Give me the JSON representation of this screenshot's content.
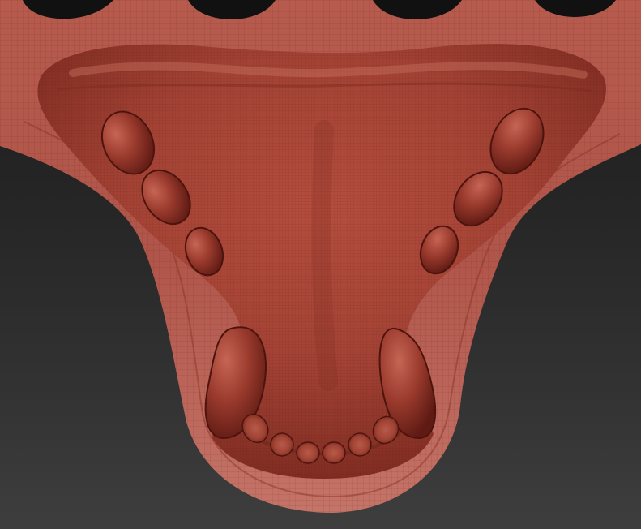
{
  "scene": {
    "subject": "sculpted-jaw-model",
    "background_color": "#2e2e2e",
    "material_color": "#a8493d",
    "wire_color": "#5c1d16"
  }
}
